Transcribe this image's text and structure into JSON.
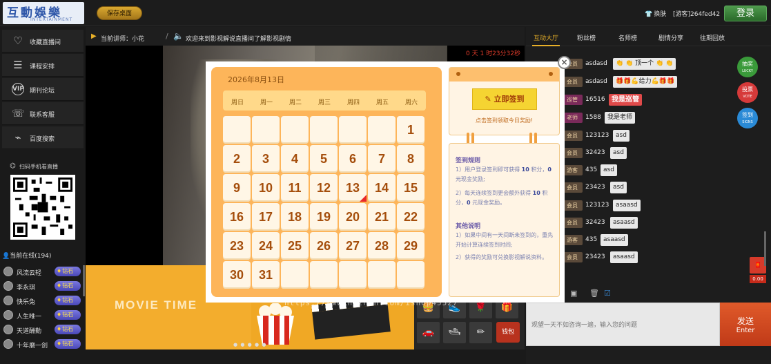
{
  "header": {
    "logo_main": "互動娛樂",
    "logo_sub": "INTERTAINMENT",
    "save_desktop": "保存桌面",
    "skin": "换肤",
    "guest": "[游客]264fed42",
    "login": "登录"
  },
  "sidebar": {
    "items": [
      {
        "label": "收藏直播间",
        "icon": "heart-icon"
      },
      {
        "label": "课程安排",
        "icon": "schedule-icon"
      },
      {
        "label": "期刊论坛",
        "icon": "vip-icon"
      },
      {
        "label": "联系客服",
        "icon": "service-icon"
      },
      {
        "label": "百度搜索",
        "icon": "chart-icon"
      }
    ],
    "scan_label": "扫码手机看直播",
    "online_label": "当前在线(194)",
    "users": [
      {
        "name": "风流云轻",
        "badge": "钻石"
      },
      {
        "name": "李永琪",
        "badge": "钻石"
      },
      {
        "name": "快乐兔",
        "badge": "钻石"
      },
      {
        "name": "人生唯一",
        "badge": "钻石"
      },
      {
        "name": "天道酬勤",
        "badge": "钻石"
      },
      {
        "name": "十年磨一剑",
        "badge": "钻石"
      }
    ]
  },
  "center": {
    "lecturer": "当前讲师：小花",
    "notice": "欢迎来到影视解说直播间了解影视剧情",
    "elapsed": "0 天 1 时23分32秒",
    "banner_text": "MOVIE TIME",
    "wallet": "钱包"
  },
  "chat": {
    "tabs": [
      "互动大厅",
      "粉丝榜",
      "名师榜",
      "剧情分享",
      "往期回放"
    ],
    "rows": [
      {
        "role": "会员",
        "name": "asdasd",
        "msg": "👏 👏 顶一个 👏 👏"
      },
      {
        "role": "会员",
        "name": "asdasd",
        "msg": "🎁🎁💪给力💪🎁🎁"
      },
      {
        "role": "巡管",
        "name": "16516",
        "msg": "我是巡管"
      },
      {
        "role": "老师",
        "name": "1588",
        "msg": "我是老师"
      },
      {
        "role": "会员",
        "name": "123123",
        "msg": "asd"
      },
      {
        "role": "会员",
        "name": "32423",
        "msg": "asd"
      },
      {
        "role": "游客",
        "name": "435",
        "msg": "asd"
      },
      {
        "role": "会员",
        "name": "23423",
        "msg": "asd"
      },
      {
        "role": "会员",
        "name": "123123",
        "msg": "asaasd"
      },
      {
        "role": "会员",
        "name": "32423",
        "msg": "asaasd"
      },
      {
        "role": "游客",
        "name": "435",
        "msg": "asaasd"
      },
      {
        "role": "会员",
        "name": "23423",
        "msg": "asaasd"
      }
    ],
    "side_buttons": [
      {
        "label": "抽奖",
        "sub": "LUCKY",
        "color": "#3a9a3a"
      },
      {
        "label": "投票",
        "sub": "VOTE",
        "color": "#d63a3a"
      },
      {
        "label": "签到",
        "sub": "SIGNS",
        "color": "#2a8ad6"
      }
    ],
    "redbox_amount": "0.00",
    "input_placeholder": "观望一天不如咨询一遍，输入您的问题",
    "send_main": "发送",
    "send_sub": "Enter"
  },
  "calendar": {
    "title": "2026年8月13日",
    "weekdays": [
      "周日",
      "周一",
      "周二",
      "周三",
      "周四",
      "周五",
      "周六"
    ],
    "first_weekday": 6,
    "days_in_month": 31,
    "today": 13,
    "sign_button": "立即签到",
    "sign_tip": "点击签到领取今日奖励!",
    "rules_title": "签到规则",
    "rule1_a": "1）用户登录签到即可获得 ",
    "rule1_b": "10",
    "rule1_c": " 积分，",
    "rule1_d": "0",
    "rule1_e": " 元现金奖励;",
    "rule2_a": "2）每天连续签到更会额外获得 ",
    "rule2_b": "10",
    "rule2_c": " 积分，",
    "rule2_d": "0",
    "rule2_e": " 元现金奖励。",
    "other_title": "其他说明",
    "other1": "1）如果中间有一天间断未签到的，重先开始计算连续签到时间;",
    "other2": "2）获得的奖励可兑换影视解说资料。"
  },
  "watermark": "https://www.huzhan.com/ishop45527"
}
